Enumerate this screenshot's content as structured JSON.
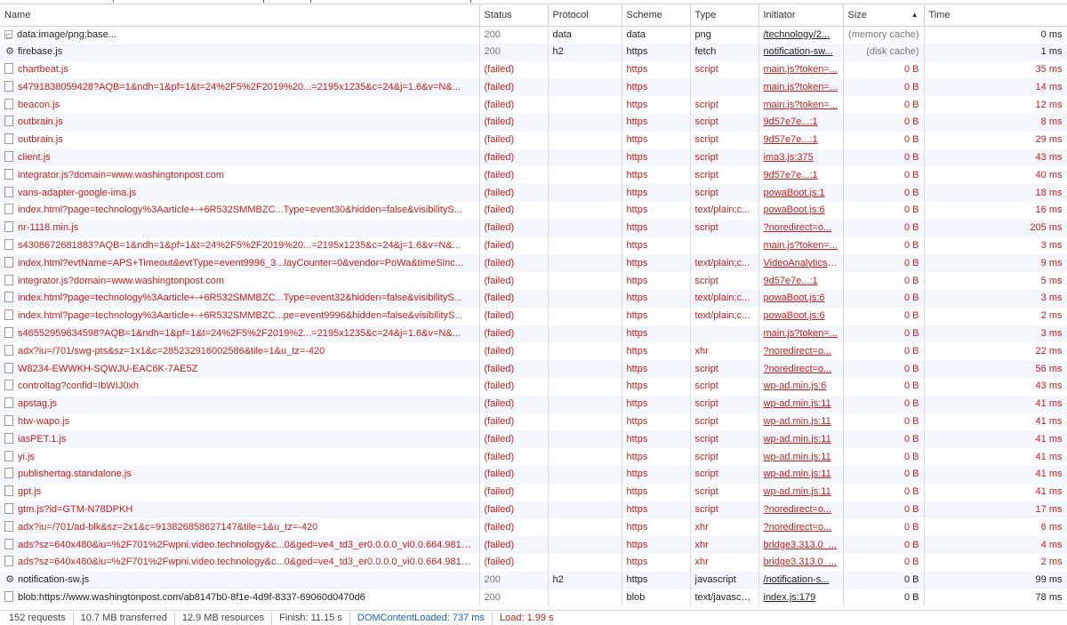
{
  "columns": {
    "name": "Name",
    "status": "Status",
    "protocol": "Protocol",
    "scheme": "Scheme",
    "type": "Type",
    "initiator": "Initiator",
    "size": "Size",
    "time": "Time",
    "sort_indicator": "▲"
  },
  "colors": {
    "failed": "#d21c1c",
    "dom_content_loaded": "#1a62c9",
    "load": "#c0261f"
  },
  "requests": [
    {
      "icon": "image-file-icon",
      "name": "data:image/png;base...",
      "status": "200",
      "protocol": "data",
      "scheme": "data",
      "type": "png",
      "initiator": "/technology/2...",
      "size": "(memory cache)",
      "time": "0 ms",
      "failed": false
    },
    {
      "icon": "gear-icon",
      "name": "firebase.js",
      "status": "200",
      "protocol": "h2",
      "scheme": "https",
      "type": "fetch",
      "initiator": "notification-sw...",
      "size": "(disk cache)",
      "time": "1 ms",
      "failed": false
    },
    {
      "icon": "file-icon",
      "name": "chartbeat.js",
      "status": "(failed)",
      "protocol": "",
      "scheme": "https",
      "type": "script",
      "initiator": "main.js?token=...",
      "size": "0 B",
      "time": "35 ms",
      "failed": true
    },
    {
      "icon": "file-icon",
      "name": "s4791838059428?AQB=1&ndh=1&pf=1&t=24%2F5%2F2019%20...=2195x1235&c=24&j=1.6&v=N&...",
      "status": "(failed)",
      "protocol": "",
      "scheme": "https",
      "type": "",
      "initiator": "main.js?token=...",
      "size": "0 B",
      "time": "14 ms",
      "failed": true
    },
    {
      "icon": "file-icon",
      "name": "beacon.js",
      "status": "(failed)",
      "protocol": "",
      "scheme": "https",
      "type": "script",
      "initiator": "main.js?token=...",
      "size": "0 B",
      "time": "12 ms",
      "failed": true
    },
    {
      "icon": "file-icon",
      "name": "outbrain.js",
      "status": "(failed)",
      "protocol": "",
      "scheme": "https",
      "type": "script",
      "initiator": "9d57e7e...:1",
      "size": "0 B",
      "time": "8 ms",
      "failed": true
    },
    {
      "icon": "file-icon",
      "name": "outbrain.js",
      "status": "(failed)",
      "protocol": "",
      "scheme": "https",
      "type": "script",
      "initiator": "9d57e7e...:1",
      "size": "0 B",
      "time": "29 ms",
      "failed": true
    },
    {
      "icon": "file-icon",
      "name": "client.js",
      "status": "(failed)",
      "protocol": "",
      "scheme": "https",
      "type": "script",
      "initiator": "ima3.js:375",
      "size": "0 B",
      "time": "43 ms",
      "failed": true
    },
    {
      "icon": "file-icon",
      "name": "integrator.js?domain=www.washingtonpost.com",
      "status": "(failed)",
      "protocol": "",
      "scheme": "https",
      "type": "script",
      "initiator": "9d57e7e...:1",
      "size": "0 B",
      "time": "40 ms",
      "failed": true
    },
    {
      "icon": "file-icon",
      "name": "vans-adapter-google-ima.js",
      "status": "(failed)",
      "protocol": "",
      "scheme": "https",
      "type": "script",
      "initiator": "powaBoot.js:1",
      "size": "0 B",
      "time": "18 ms",
      "failed": true
    },
    {
      "icon": "file-icon",
      "name": "index.html?page=technology%3Aarticle+-+6R532SMMBZC...Type=event30&hidden=false&visibilityS...",
      "status": "(failed)",
      "protocol": "",
      "scheme": "https",
      "type": "text/plain;c...",
      "initiator": "powaBoot.js:6",
      "size": "0 B",
      "time": "16 ms",
      "failed": true
    },
    {
      "icon": "file-icon",
      "name": "nr-1118.min.js",
      "status": "(failed)",
      "protocol": "",
      "scheme": "https",
      "type": "script",
      "initiator": "?noredirect=o...",
      "size": "0 B",
      "time": "205 ms",
      "failed": true
    },
    {
      "icon": "file-icon",
      "name": "s4308672681883?AQB=1&ndh=1&pf=1&t=24%2F5%2F2019%20...=2195x1235&c=24&j=1.6&v=N&...",
      "status": "(failed)",
      "protocol": "",
      "scheme": "https",
      "type": "",
      "initiator": "main.js?token=...",
      "size": "0 B",
      "time": "3 ms",
      "failed": true
    },
    {
      "icon": "file-icon",
      "name": "index.html?evtName=APS+Timeout&evtType=event9996_3...layCounter=0&vendor=PoWa&timeSinc...",
      "status": "(failed)",
      "protocol": "",
      "scheme": "https",
      "type": "text/plain;c...",
      "initiator": "VideoAnalytics....",
      "size": "0 B",
      "time": "9 ms",
      "failed": true
    },
    {
      "icon": "file-icon",
      "name": "integrator.js?domain=www.washingtonpost.com",
      "status": "(failed)",
      "protocol": "",
      "scheme": "https",
      "type": "script",
      "initiator": "9d57e7e...:1",
      "size": "0 B",
      "time": "5 ms",
      "failed": true
    },
    {
      "icon": "file-icon",
      "name": "index.html?page=technology%3Aarticle+-+6R532SMMBZC...Type=event32&hidden=false&visibilityS...",
      "status": "(failed)",
      "protocol": "",
      "scheme": "https",
      "type": "text/plain;c...",
      "initiator": "powaBoot.js:6",
      "size": "0 B",
      "time": "3 ms",
      "failed": true
    },
    {
      "icon": "file-icon",
      "name": "index.html?page=technology%3Aarticle+-+6R532SMMBZC...pe=event9996&hidden=false&visibilityS...",
      "status": "(failed)",
      "protocol": "",
      "scheme": "https",
      "type": "text/plain;c...",
      "initiator": "powaBoot.js:6",
      "size": "0 B",
      "time": "2 ms",
      "failed": true
    },
    {
      "icon": "file-icon",
      "name": "s46552959634598?AQB=1&ndh=1&pf=1&t=24%2F5%2F2019%2...=2195x1235&c=24&j=1.6&v=N&...",
      "status": "(failed)",
      "protocol": "",
      "scheme": "https",
      "type": "",
      "initiator": "main.js?token=...",
      "size": "0 B",
      "time": "3 ms",
      "failed": true
    },
    {
      "icon": "file-icon",
      "name": "adx?iu=/701/swg-pts&sz=1x1&c=285232916002586&tile=1&u_tz=-420",
      "status": "(failed)",
      "protocol": "",
      "scheme": "https",
      "type": "xhr",
      "initiator": "?noredirect=o...",
      "size": "0 B",
      "time": "22 ms",
      "failed": true
    },
    {
      "icon": "file-icon",
      "name": "W8234-EWWKH-SQWJU-EAC6K-7AE5Z",
      "status": "(failed)",
      "protocol": "",
      "scheme": "https",
      "type": "script",
      "initiator": "?noredirect=o...",
      "size": "0 B",
      "time": "56 ms",
      "failed": true
    },
    {
      "icon": "file-icon",
      "name": "controltag?confid=IbWIJ0xh",
      "status": "(failed)",
      "protocol": "",
      "scheme": "https",
      "type": "script",
      "initiator": "wp-ad.min.js:6",
      "size": "0 B",
      "time": "43 ms",
      "failed": true
    },
    {
      "icon": "file-icon",
      "name": "apstag.js",
      "status": "(failed)",
      "protocol": "",
      "scheme": "https",
      "type": "script",
      "initiator": "wp-ad.min.js:11",
      "size": "0 B",
      "time": "41 ms",
      "failed": true
    },
    {
      "icon": "file-icon",
      "name": "htw-wapo.js",
      "status": "(failed)",
      "protocol": "",
      "scheme": "https",
      "type": "script",
      "initiator": "wp-ad.min.js:11",
      "size": "0 B",
      "time": "41 ms",
      "failed": true
    },
    {
      "icon": "file-icon",
      "name": "iasPET.1.js",
      "status": "(failed)",
      "protocol": "",
      "scheme": "https",
      "type": "script",
      "initiator": "wp-ad.min.js:11",
      "size": "0 B",
      "time": "41 ms",
      "failed": true
    },
    {
      "icon": "file-icon",
      "name": "yi.js",
      "status": "(failed)",
      "protocol": "",
      "scheme": "https",
      "type": "script",
      "initiator": "wp-ad.min.js:11",
      "size": "0 B",
      "time": "41 ms",
      "failed": true
    },
    {
      "icon": "file-icon",
      "name": "publishertag.standalone.js",
      "status": "(failed)",
      "protocol": "",
      "scheme": "https",
      "type": "script",
      "initiator": "wp-ad.min.js:11",
      "size": "0 B",
      "time": "41 ms",
      "failed": true
    },
    {
      "icon": "file-icon",
      "name": "gpt.js",
      "status": "(failed)",
      "protocol": "",
      "scheme": "https",
      "type": "script",
      "initiator": "wp-ad.min.js:11",
      "size": "0 B",
      "time": "41 ms",
      "failed": true
    },
    {
      "icon": "file-icon",
      "name": "gtm.js?id=GTM-N78DPKH",
      "status": "(failed)",
      "protocol": "",
      "scheme": "https",
      "type": "script",
      "initiator": "?noredirect=o...",
      "size": "0 B",
      "time": "17 ms",
      "failed": true
    },
    {
      "icon": "file-icon",
      "name": "adx?iu=/701/ad-blk&sz=2x1&c=913826858627147&tile=1&u_tz=-420",
      "status": "(failed)",
      "protocol": "",
      "scheme": "https",
      "type": "xhr",
      "initiator": "?noredirect=o...",
      "size": "0 B",
      "time": "6 ms",
      "failed": true
    },
    {
      "icon": "file-icon",
      "name": "ads?sz=640x480&iu=%2F701%2Fwpni.video.technology&c...0&ged=ve4_td3_er0.0.0.0_vi0.0.664.981_...",
      "status": "(failed)",
      "protocol": "",
      "scheme": "https",
      "type": "xhr",
      "initiator": "bridge3.313.0_...",
      "size": "0 B",
      "time": "4 ms",
      "failed": true
    },
    {
      "icon": "file-icon",
      "name": "ads?sz=640x480&iu=%2F701%2Fwpni.video.technology&c...0&ged=ve4_td3_er0.0.0.0_vi0.0.664.981_...",
      "status": "(failed)",
      "protocol": "",
      "scheme": "https",
      "type": "xhr",
      "initiator": "bridge3.313.0_...",
      "size": "0 B",
      "time": "2 ms",
      "failed": true
    },
    {
      "icon": "gear-icon",
      "name": "notification-sw.js",
      "status": "200",
      "protocol": "h2",
      "scheme": "https",
      "type": "javascript",
      "initiator": "/notification-s...",
      "size": "0 B",
      "time": "99 ms",
      "failed": false
    },
    {
      "icon": "file-icon",
      "name": "blob:https://www.washingtonpost.com/ab8147b0-8f1e-4d9f-8337-69060d0470d6",
      "status": "200",
      "protocol": "",
      "scheme": "blob",
      "type": "text/javascri...",
      "initiator": "index.js:179",
      "size": "0 B",
      "time": "78 ms",
      "failed": false
    }
  ],
  "summary": {
    "requests": "152 requests",
    "transferred": "10.7 MB transferred",
    "resources": "12.9 MB resources",
    "finish": "Finish: 11.15 s",
    "dom_content_loaded": "DOMContentLoaded: 737 ms",
    "load": "Load: 1.99 s"
  }
}
